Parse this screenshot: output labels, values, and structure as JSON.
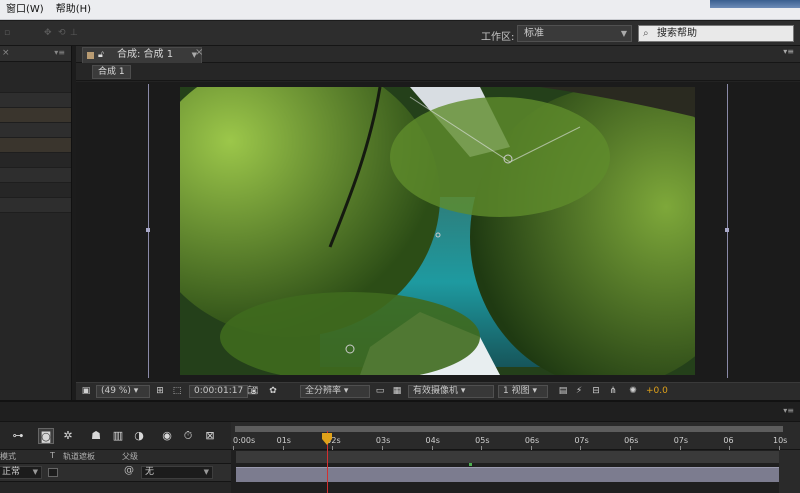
{
  "menubar": {
    "items": [
      {
        "label": "窗口(W)"
      },
      {
        "label": "帮助(H)"
      }
    ]
  },
  "workspace": {
    "label": "工作区:",
    "value": "标准",
    "search_placeholder": "搜索帮助"
  },
  "comp_panel": {
    "tab_label": "合成: 合成 1",
    "breadcrumb": "合成 1",
    "image": "jiuzhaigou-lake-forest-distorted",
    "toolbar": {
      "zoom": "(49 %)",
      "timecode": "0:00:01:17",
      "resolution": "全分辨率",
      "camera": "有效摄像机",
      "view": "1 视图",
      "exposure": "+0.0"
    }
  },
  "timeline": {
    "columns": {
      "mode": "模式",
      "t": "T",
      "trkmat": "轨道遮板",
      "parent": "父级"
    },
    "layer": {
      "mode": "正常",
      "parent": "无"
    },
    "ruler_ticks": [
      "0:00s",
      "01s",
      "02s",
      "03s",
      "04s",
      "05s",
      "06s",
      "07s",
      "06s",
      "07s",
      "06",
      "10s"
    ],
    "playhead_time_s": 1.7
  },
  "colors": {
    "accent_orange": "#e0a21a",
    "playhead": "#d23030",
    "layer_bar": "#7c7c8f"
  }
}
